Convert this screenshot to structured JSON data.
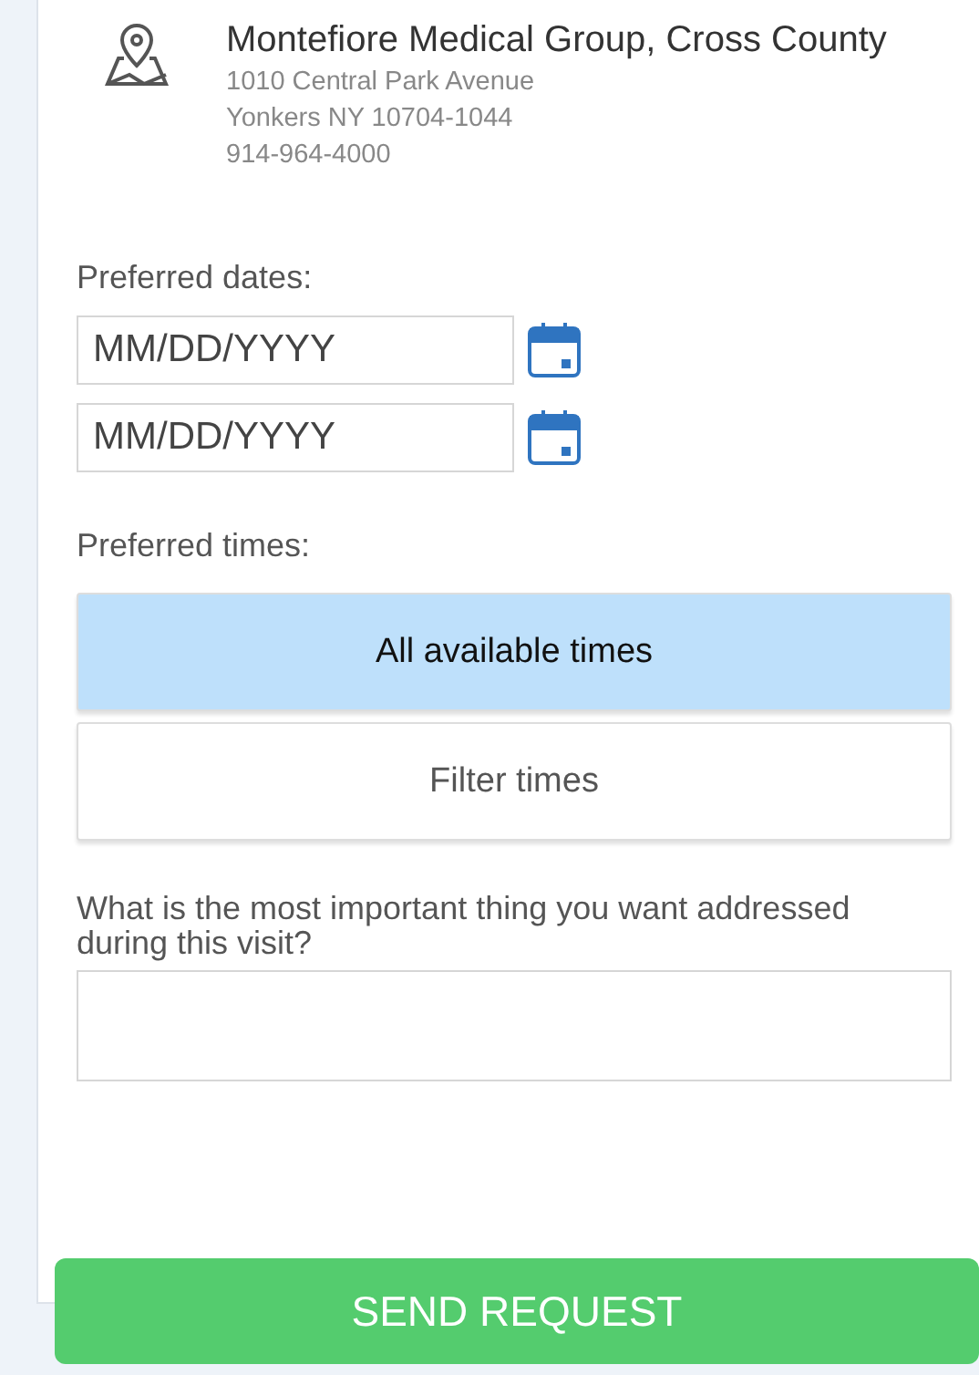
{
  "location": {
    "name": "Montefiore Medical Group, Cross County",
    "address_lines": [
      "1010 Central Park Avenue",
      "Yonkers NY 10704-1044",
      "914-964-4000"
    ]
  },
  "dates": {
    "label": "Preferred dates:",
    "fields": [
      {
        "placeholder": "MM/DD/YYYY"
      },
      {
        "placeholder": "MM/DD/YYYY"
      }
    ]
  },
  "times": {
    "label": "Preferred times:",
    "options": [
      {
        "label": "All available times",
        "selected": true
      },
      {
        "label": "Filter times",
        "selected": false
      }
    ]
  },
  "question": {
    "label": "What is the most important thing you want addressed during this visit?"
  },
  "submit": "SEND REQUEST"
}
